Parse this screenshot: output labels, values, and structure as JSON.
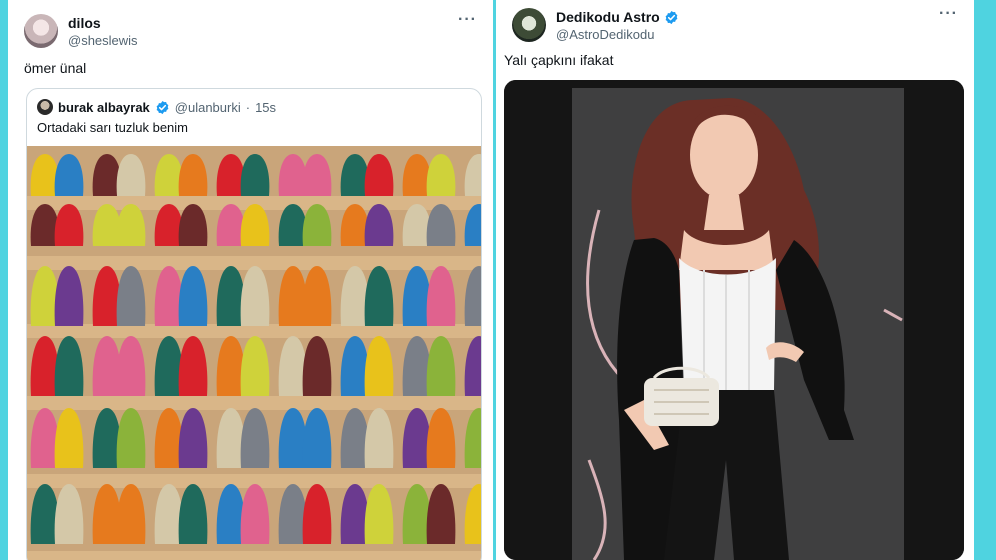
{
  "left_tweet": {
    "display_name": "dilos",
    "handle": "@sheslewis",
    "more_icon": "···",
    "text": "ömer ünal",
    "quote": {
      "display_name": "burak albayrak",
      "handle": "@ulanburki",
      "separator": "·",
      "time": "15s",
      "text": "Ortadaki sarı tuzluk benim",
      "media_icon": "hugging-figurines-photo"
    }
  },
  "right_tweet": {
    "display_name": "Dedikodu Astro",
    "handle": "@AstroDedikodu",
    "more_icon": "···",
    "text": "Yalı çapkını ifakat",
    "media_icon": "red-carpet-photo"
  },
  "colors": {
    "accent_cyan": "#4fd3e0",
    "verified_blue": "#1d9bf0",
    "text_primary": "#0f1419",
    "text_secondary": "#536471"
  }
}
